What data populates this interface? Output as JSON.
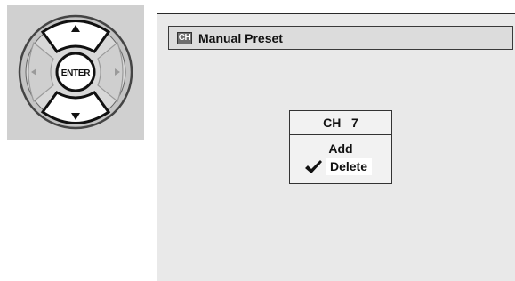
{
  "remote": {
    "enter_label": "ENTER",
    "buttons": [
      "up-arrow",
      "down-arrow",
      "left-arrow",
      "right-arrow",
      "enter"
    ]
  },
  "screen": {
    "title_icon_label": "CH",
    "title": "Manual Preset",
    "menu": {
      "header": "CH   7",
      "items": [
        {
          "label": "Add",
          "checked": false
        },
        {
          "label": "Delete",
          "checked": true
        }
      ]
    }
  },
  "colors": {
    "remote_bg": "#d0d0d0",
    "screen_bg": "#e9e9e9",
    "title_bar_bg": "#dcdcdc",
    "highlight": "#ffffff",
    "text": "#111111"
  }
}
